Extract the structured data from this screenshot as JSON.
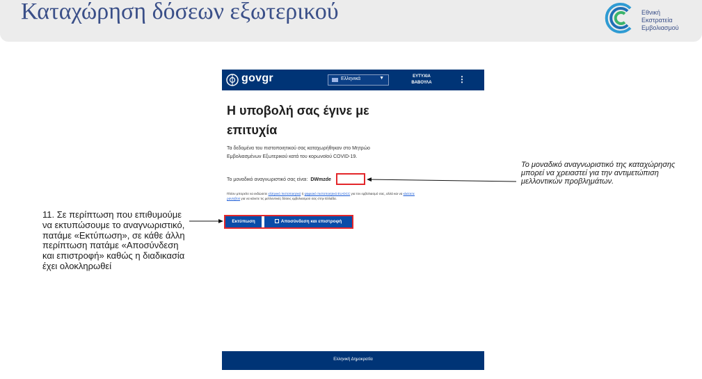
{
  "slide": {
    "title": "Καταχώρηση δόσεων εξωτερικού",
    "logo_text": "Εθνική\nΕκστρατεία\nΕμβολιασμού"
  },
  "screenshot": {
    "header": {
      "logo_text": "govgr",
      "language": "Ελληνικά",
      "user_name": "ΕΥΤΥΧΙΑ\nΒΑΒΟΥΛΑ"
    },
    "success_title": "Η υποβολή σας έγινε με επιτυχία",
    "paragraph": "Τα δεδομένα του πιστοποιητικού σας καταχωρήθηκαν στο Μητρώο Εμβολιασμένων Εξωτερικού κατά του κορωνοϊού COVID-19.",
    "id_label": "Το μοναδικό αναγνωριστικό σας είναι:",
    "id_value": "DWmzde",
    "info": {
      "part1": "Πλέον μπορείτε να εκδώσετε ",
      "link1": "ελληνικό πιστοποιητικό",
      "part2": " ή ",
      "link2": "ψηφιακό πιστοποιητικό EU-DCC",
      "part3": " για τον εμβολιασμό σας, αλλά και να ",
      "link3": "κλείσετε ραντεβού",
      "part4": " για να κάνετε τις μελλοντικές δόσεις εμβολιασμού σας στην Ελλάδα."
    },
    "buttons": {
      "print": "Εκτύπωση",
      "logout": "Αποσύνδεση και επιστροφή"
    },
    "footer": "Ελληνική Δημοκρατία"
  },
  "annotations": {
    "right": "Το μοναδικό αναγνωριστικό της καταχώρησης μπορεί να χρειαστεί για την αντιμετώπιση μελλοντικών προβλημάτων.",
    "left": "11. Σε περίπτωση που επιθυμούμε να εκτυπώσουμε το αναγνωριστικό, πατάμε «Εκτύπωση», σε κάθε άλλη περίπτωση πατάμε «Αποσύνδεση και επιστροφή» καθώς η διαδικασία έχει ολοκληρωθεί"
  },
  "colors": {
    "title": "#3a4f88",
    "gov_blue": "#003476",
    "button_blue": "#0a4ca8",
    "highlight_red": "#e3262a"
  },
  "icons": [
    "campaign-logo-icon",
    "gov-emblem-icon",
    "flag-icon",
    "chevron-down-icon",
    "kebab-menu-icon",
    "logout-icon"
  ]
}
